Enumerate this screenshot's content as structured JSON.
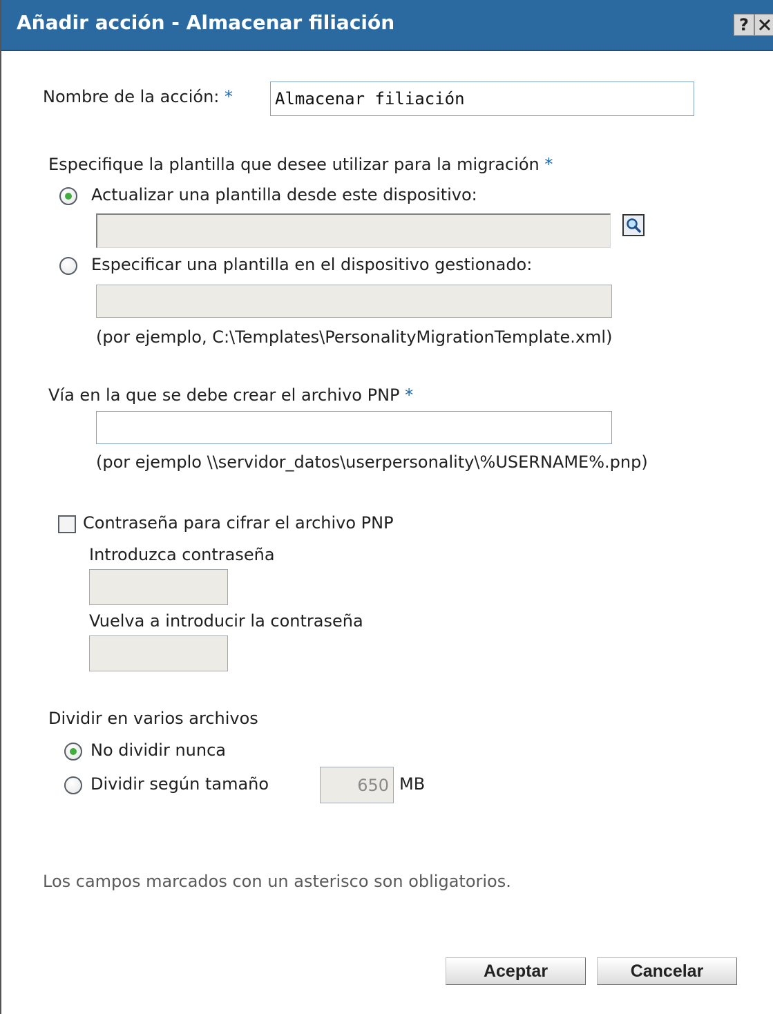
{
  "window": {
    "title": "Añadir acción - Almacenar filiación",
    "help_label": "?",
    "close_label": "✕"
  },
  "action_name": {
    "label": "Nombre de la acción:",
    "required_mark": "*",
    "value": "Almacenar filiación"
  },
  "template": {
    "heading": "Especifique la plantilla que desee utilizar para la migración",
    "required_mark": "*",
    "option_upload_label": "Actualizar una plantilla desde este dispositivo:",
    "option_upload_selected": true,
    "upload_path_value": "",
    "option_managed_label": "Especificar una plantilla en el dispositivo gestionado:",
    "option_managed_selected": false,
    "managed_path_value": "",
    "managed_example": "(por ejemplo, C:\\Templates\\PersonalityMigrationTemplate.xml)"
  },
  "pnp_path": {
    "label": "Vía en la que se debe crear el archivo PNP",
    "required_mark": "*",
    "value": "",
    "example": "(por ejemplo \\\\servidor_datos\\userpersonality\\%USERNAME%.pnp)"
  },
  "encryption": {
    "checkbox_label": "Contraseña para cifrar el archivo PNP",
    "checked": false,
    "password_label": "Introduzca contraseña",
    "password_value": "",
    "confirm_label": "Vuelva a introducir la contraseña",
    "confirm_value": ""
  },
  "split": {
    "heading": "Dividir en varios archivos",
    "option_never_label": "No dividir nunca",
    "option_never_selected": true,
    "option_size_label": "Dividir según tamaño",
    "option_size_selected": false,
    "size_value": "650",
    "size_unit": "MB"
  },
  "footer": {
    "required_note": "Los campos marcados con un asterisco son obligatorios.",
    "ok_label": "Aceptar",
    "cancel_label": "Cancelar"
  },
  "colors": {
    "titlebar": "#2b6aa0",
    "required_asterisk": "#2266aa",
    "radio_selected": "#3fae3f"
  }
}
